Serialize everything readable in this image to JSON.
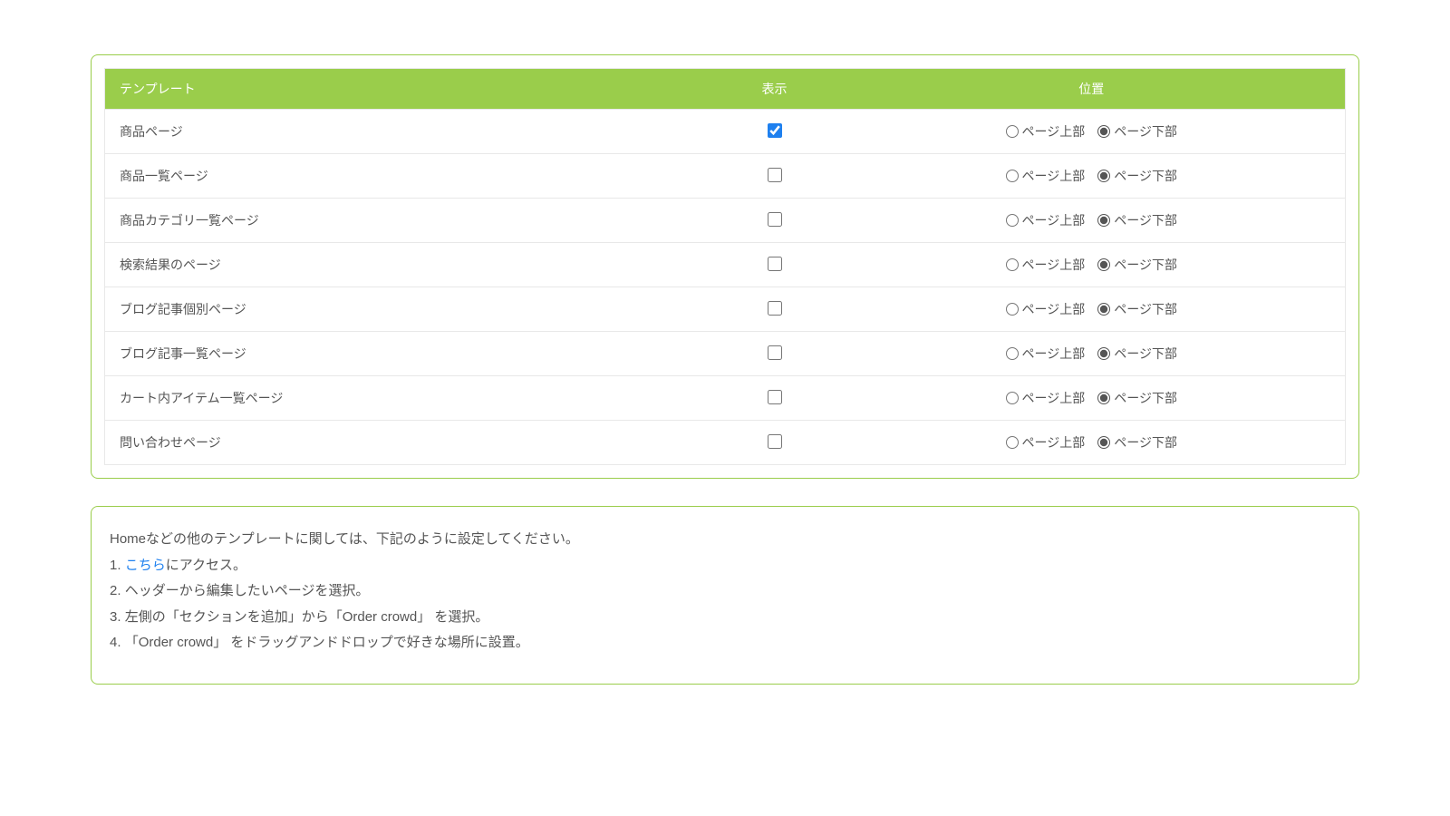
{
  "table": {
    "headers": {
      "template": "テンプレート",
      "display": "表示",
      "position": "位置"
    },
    "position_labels": {
      "top": "ページ上部",
      "bottom": "ページ下部"
    },
    "rows": [
      {
        "name": "商品ページ",
        "display": true,
        "position": "bottom"
      },
      {
        "name": "商品一覧ページ",
        "display": false,
        "position": "bottom"
      },
      {
        "name": "商品カテゴリ一覧ページ",
        "display": false,
        "position": "bottom"
      },
      {
        "name": "検索結果のページ",
        "display": false,
        "position": "bottom"
      },
      {
        "name": "ブログ記事個別ページ",
        "display": false,
        "position": "bottom"
      },
      {
        "name": "ブログ記事一覧ページ",
        "display": false,
        "position": "bottom"
      },
      {
        "name": "カート内アイテム一覧ページ",
        "display": false,
        "position": "bottom"
      },
      {
        "name": "問い合わせページ",
        "display": false,
        "position": "bottom"
      }
    ]
  },
  "info": {
    "intro": "Homeなどの他のテンプレートに関しては、下記のように設定してください。",
    "step1_link": "こちら",
    "step1_rest": "にアクセス。",
    "step2": "ヘッダーから編集したいページを選択。",
    "step3": "左側の「セクションを追加」から「Order crowd」 を選択。",
    "step4": " 「Order crowd」 をドラッグアンドドロップで好きな場所に設置。"
  }
}
